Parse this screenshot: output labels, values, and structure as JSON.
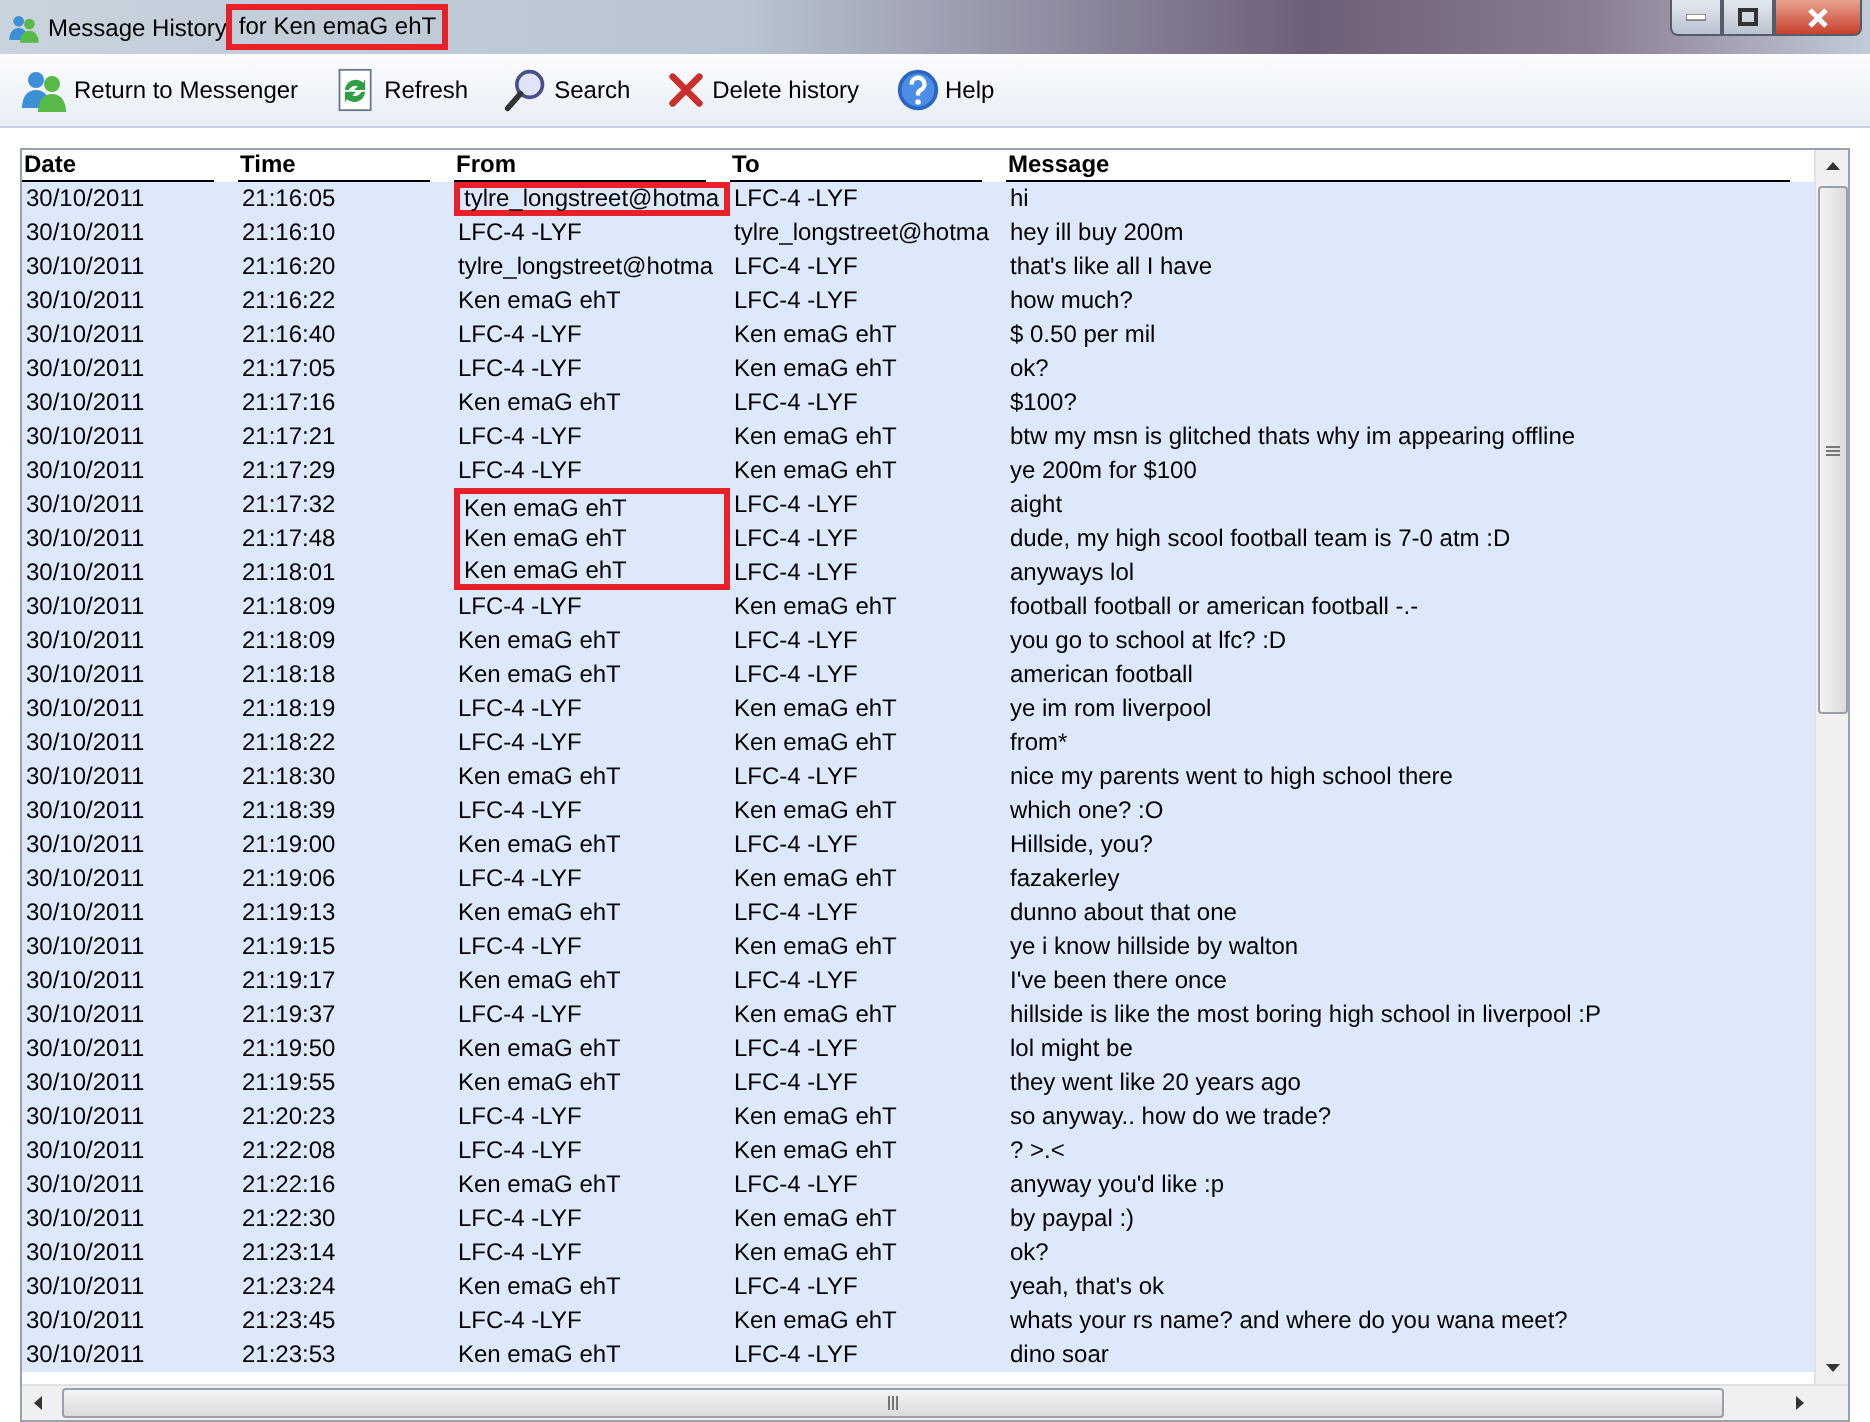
{
  "window": {
    "title_parts": [
      {
        "text": "Message History ",
        "marked": false
      },
      {
        "text": "for Ken emaG ehT",
        "marked": true
      }
    ]
  },
  "toolbar": [
    {
      "kind": "contacts",
      "label": "Return to Messenger"
    },
    {
      "kind": "refresh",
      "label": "Refresh"
    },
    {
      "kind": "search",
      "label": "Search"
    },
    {
      "kind": "delete",
      "label": "Delete history"
    },
    {
      "kind": "help",
      "label": "Help"
    }
  ],
  "table": {
    "columns": [
      "Date",
      "Time",
      "From",
      "To",
      "Message"
    ],
    "rows": [
      {
        "date": "30/10/2011",
        "time": "21:16:05",
        "from": "tylre_longstreet@hotma",
        "to": "LFC-4 -LYF",
        "message": "hi",
        "from_marked": true
      },
      {
        "date": "30/10/2011",
        "time": "21:16:10",
        "from": "LFC-4 -LYF",
        "to": "tylre_longstreet@hotma",
        "message": "hey ill buy 200m",
        "from_marked": false
      },
      {
        "date": "30/10/2011",
        "time": "21:16:20",
        "from": "tylre_longstreet@hotma",
        "to": "LFC-4 -LYF",
        "message": "that's like all I have",
        "from_marked": false
      },
      {
        "date": "30/10/2011",
        "time": "21:16:22",
        "from": "Ken emaG ehT",
        "to": "LFC-4 -LYF",
        "message": "how much?",
        "from_marked": false
      },
      {
        "date": "30/10/2011",
        "time": "21:16:40",
        "from": "LFC-4 -LYF",
        "to": "Ken emaG ehT",
        "message": "$ 0.50 per mil",
        "from_marked": false
      },
      {
        "date": "30/10/2011",
        "time": "21:17:05",
        "from": "LFC-4 -LYF",
        "to": "Ken emaG ehT",
        "message": "ok?",
        "from_marked": false
      },
      {
        "date": "30/10/2011",
        "time": "21:17:16",
        "from": "Ken emaG ehT",
        "to": "LFC-4 -LYF",
        "message": "$100?",
        "from_marked": false
      },
      {
        "date": "30/10/2011",
        "time": "21:17:21",
        "from": "LFC-4 -LYF",
        "to": "Ken emaG ehT",
        "message": "btw my msn is glitched thats why im appearing offline",
        "from_marked": false
      },
      {
        "date": "30/10/2011",
        "time": "21:17:29",
        "from": "LFC-4 -LYF",
        "to": "Ken emaG ehT",
        "message": "ye 200m for $100",
        "from_marked": false
      },
      {
        "date": "30/10/2011",
        "time": "21:17:32",
        "from": "Ken emaG ehT",
        "to": "LFC-4 -LYF",
        "message": "aight",
        "from_marked": true
      },
      {
        "date": "30/10/2011",
        "time": "21:17:48",
        "from": "Ken emaG ehT",
        "to": "LFC-4 -LYF",
        "message": "dude, my high scool football team is 7-0 atm :D",
        "from_marked": true
      },
      {
        "date": "30/10/2011",
        "time": "21:18:01",
        "from": "Ken emaG ehT",
        "to": "LFC-4 -LYF",
        "message": "anyways lol",
        "from_marked": true
      },
      {
        "date": "30/10/2011",
        "time": "21:18:09",
        "from": "LFC-4 -LYF",
        "to": "Ken emaG ehT",
        "message": "football football or american football -.-",
        "from_marked": false
      },
      {
        "date": "30/10/2011",
        "time": "21:18:09",
        "from": "Ken emaG ehT",
        "to": "LFC-4 -LYF",
        "message": "you go to school at lfc? :D",
        "from_marked": false
      },
      {
        "date": "30/10/2011",
        "time": "21:18:18",
        "from": "Ken emaG ehT",
        "to": "LFC-4 -LYF",
        "message": "american football",
        "from_marked": false
      },
      {
        "date": "30/10/2011",
        "time": "21:18:19",
        "from": "LFC-4 -LYF",
        "to": "Ken emaG ehT",
        "message": "ye im rom liverpool",
        "from_marked": false
      },
      {
        "date": "30/10/2011",
        "time": "21:18:22",
        "from": "LFC-4 -LYF",
        "to": "Ken emaG ehT",
        "message": "from*",
        "from_marked": false
      },
      {
        "date": "30/10/2011",
        "time": "21:18:30",
        "from": "Ken emaG ehT",
        "to": "LFC-4 -LYF",
        "message": "nice my parents went to high school there",
        "from_marked": false
      },
      {
        "date": "30/10/2011",
        "time": "21:18:39",
        "from": "LFC-4 -LYF",
        "to": "Ken emaG ehT",
        "message": "which one? :O",
        "from_marked": false
      },
      {
        "date": "30/10/2011",
        "time": "21:19:00",
        "from": "Ken emaG ehT",
        "to": "LFC-4 -LYF",
        "message": "Hillside, you?",
        "from_marked": false
      },
      {
        "date": "30/10/2011",
        "time": "21:19:06",
        "from": "LFC-4 -LYF",
        "to": "Ken emaG ehT",
        "message": "fazakerley",
        "from_marked": false
      },
      {
        "date": "30/10/2011",
        "time": "21:19:13",
        "from": "Ken emaG ehT",
        "to": "LFC-4 -LYF",
        "message": "dunno about that one",
        "from_marked": false
      },
      {
        "date": "30/10/2011",
        "time": "21:19:15",
        "from": "LFC-4 -LYF",
        "to": "Ken emaG ehT",
        "message": "ye i know hillside by walton",
        "from_marked": false
      },
      {
        "date": "30/10/2011",
        "time": "21:19:17",
        "from": "Ken emaG ehT",
        "to": "LFC-4 -LYF",
        "message": "I've been there once",
        "from_marked": false
      },
      {
        "date": "30/10/2011",
        "time": "21:19:37",
        "from": "LFC-4 -LYF",
        "to": "Ken emaG ehT",
        "message": "hillside is like the most boring high school in liverpool :P",
        "from_marked": false
      },
      {
        "date": "30/10/2011",
        "time": "21:19:50",
        "from": "Ken emaG ehT",
        "to": "LFC-4 -LYF",
        "message": "lol might be",
        "from_marked": false
      },
      {
        "date": "30/10/2011",
        "time": "21:19:55",
        "from": "Ken emaG ehT",
        "to": "LFC-4 -LYF",
        "message": "they went like 20 years ago",
        "from_marked": false
      },
      {
        "date": "30/10/2011",
        "time": "21:20:23",
        "from": "LFC-4 -LYF",
        "to": "Ken emaG ehT",
        "message": "so anyway.. how do we trade?",
        "from_marked": false
      },
      {
        "date": "30/10/2011",
        "time": "21:22:08",
        "from": "LFC-4 -LYF",
        "to": "Ken emaG ehT",
        "message": "? >.<",
        "from_marked": false
      },
      {
        "date": "30/10/2011",
        "time": "21:22:16",
        "from": "Ken emaG ehT",
        "to": "LFC-4 -LYF",
        "message": "anyway you'd like :p",
        "from_marked": false
      },
      {
        "date": "30/10/2011",
        "time": "21:22:30",
        "from": "LFC-4 -LYF",
        "to": "Ken emaG ehT",
        "message": "by paypal :)",
        "from_marked": false
      },
      {
        "date": "30/10/2011",
        "time": "21:23:14",
        "from": "LFC-4 -LYF",
        "to": "Ken emaG ehT",
        "message": "ok?",
        "from_marked": false
      },
      {
        "date": "30/10/2011",
        "time": "21:23:24",
        "from": "Ken emaG ehT",
        "to": "LFC-4 -LYF",
        "message": "yeah, that's ok",
        "from_marked": false
      },
      {
        "date": "30/10/2011",
        "time": "21:23:45",
        "from": "LFC-4 -LYF",
        "to": "Ken emaG ehT",
        "message": "whats your rs name? and where do you wana meet?",
        "from_marked": false
      },
      {
        "date": "30/10/2011",
        "time": "21:23:53",
        "from": "Ken emaG ehT",
        "to": "LFC-4 -LYF",
        "message": "dino soar",
        "from_marked": false
      }
    ]
  }
}
